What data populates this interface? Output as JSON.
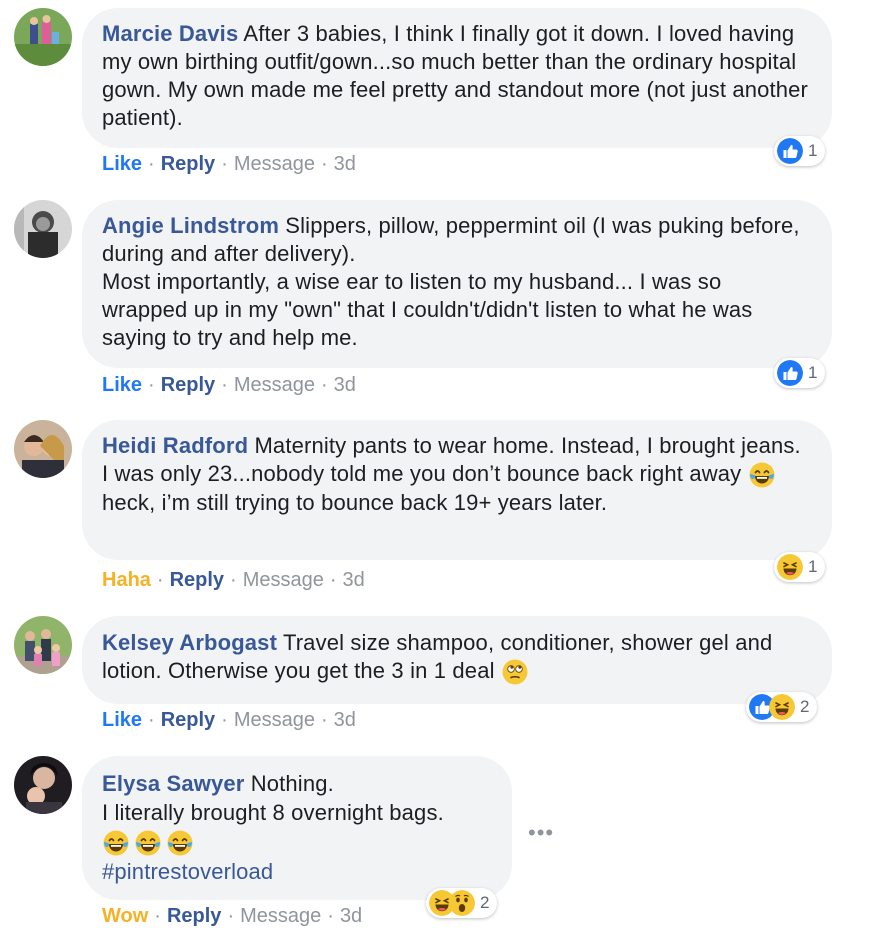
{
  "comments": [
    {
      "author": "Marcie Davis",
      "text": "After 3 babies, I think I finally got it down. I loved having my own birthing outfit/gown...so much better than the ordinary hospital gown. My own made me feel pretty and standout more (not just another patient).",
      "action": "Like",
      "reply": "Reply",
      "message": "Message",
      "time": "3d",
      "reaction_count": "1"
    },
    {
      "author": "Angie Lindstrom",
      "text_line1": "Slippers, pillow, peppermint oil (I was puking before, during and after delivery).",
      "text_line2": "Most importantly, a wise ear to listen to my husband... I was so wrapped up in my \"own\" that I couldn't/didn't listen to what he was saying to try and help me.",
      "action": "Like",
      "reply": "Reply",
      "message": "Message",
      "time": "3d",
      "reaction_count": "1"
    },
    {
      "author": "Heidi Radford",
      "text_a": "Maternity pants to wear home. Instead, I brought jeans. I was only 23...nobody told me you don’t bounce back right away",
      "text_b": "heck, i’m still trying to bounce back 19+ years later.",
      "action": "Haha",
      "reply": "Reply",
      "message": "Message",
      "time": "3d",
      "reaction_count": "1"
    },
    {
      "author": "Kelsey Arbogast",
      "text": "Travel size shampoo, conditioner, shower gel and lotion. Otherwise you get the 3 in 1 deal",
      "action": "Like",
      "reply": "Reply",
      "message": "Message",
      "time": "3d",
      "reaction_count": "2"
    },
    {
      "author": "Elysa Sawyer",
      "text_line1": "Nothing.",
      "text_line2": "I literally brought 8 overnight bags.",
      "hashtag": "#pintrestoverload",
      "action": "Wow",
      "reply": "Reply",
      "message": "Message",
      "time": "3d",
      "reaction_count": "2",
      "more": "•••"
    }
  ],
  "colors": {
    "bubble": "#f2f3f5",
    "author": "#385898",
    "like": "#2078f4",
    "haha": "#f7b125"
  }
}
